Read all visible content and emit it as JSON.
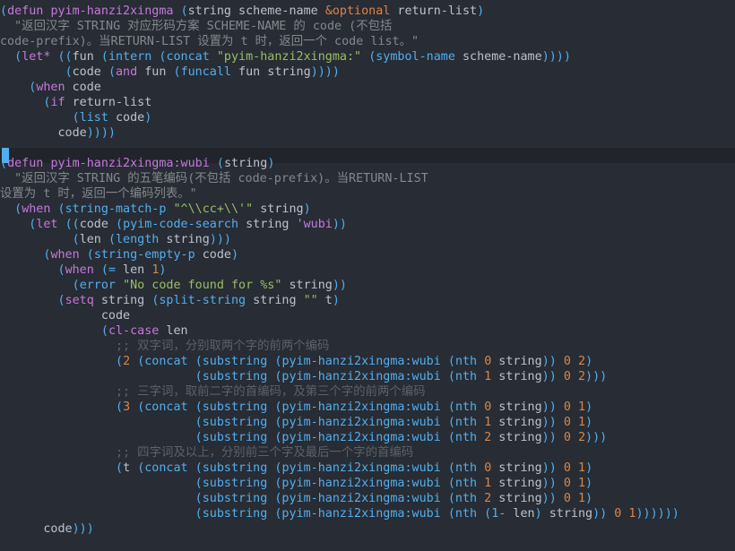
{
  "colors": {
    "background": "#282c34",
    "highlight_line": "#21242b",
    "paren": "#51afef",
    "keyword": "#c678dd",
    "string": "#98be65",
    "docstring": "#83898d",
    "comment": "#5b6268",
    "number": "#da8548",
    "text": "#bbc2cf",
    "cursor": "#51afef"
  },
  "lines": [
    [
      {
        "t": "(",
        "c": "p"
      },
      {
        "t": "defun ",
        "c": "k"
      },
      {
        "t": "pyim-hanzi2xingma",
        "c": "f"
      },
      {
        "t": " ",
        "c": "t"
      },
      {
        "t": "(",
        "c": "p"
      },
      {
        "t": "string scheme-name ",
        "c": "t"
      },
      {
        "t": "&optional",
        "c": "n"
      },
      {
        "t": " return-list",
        "c": "t"
      },
      {
        "t": ")",
        "c": "p"
      }
    ],
    [
      {
        "t": "  \"返回汉字 STRING 对应形码方案 SCHEME-NAME 的 code (不包括",
        "c": "d"
      }
    ],
    [
      {
        "t": "code-prefix)。当RETURN-LIST 设置为 t 时，返回一个 code list。\"",
        "c": "d"
      }
    ],
    [
      {
        "t": "  ",
        "c": "t"
      },
      {
        "t": "(",
        "c": "p"
      },
      {
        "t": "let*",
        "c": "k"
      },
      {
        "t": " ",
        "c": "t"
      },
      {
        "t": "((",
        "c": "p"
      },
      {
        "t": "fun ",
        "c": "t"
      },
      {
        "t": "(",
        "c": "p"
      },
      {
        "t": "intern ",
        "c": "b"
      },
      {
        "t": "(",
        "c": "p"
      },
      {
        "t": "concat ",
        "c": "b"
      },
      {
        "t": "\"pyim-hanzi2xingma:\"",
        "c": "s"
      },
      {
        "t": " ",
        "c": "t"
      },
      {
        "t": "(",
        "c": "p"
      },
      {
        "t": "symbol-name",
        "c": "b"
      },
      {
        "t": " scheme-name",
        "c": "t"
      },
      {
        "t": "))))",
        "c": "p"
      }
    ],
    [
      {
        "t": "         ",
        "c": "t"
      },
      {
        "t": "(",
        "c": "p"
      },
      {
        "t": "code ",
        "c": "t"
      },
      {
        "t": "(",
        "c": "p"
      },
      {
        "t": "and",
        "c": "k"
      },
      {
        "t": " fun ",
        "c": "t"
      },
      {
        "t": "(",
        "c": "p"
      },
      {
        "t": "funcall",
        "c": "b"
      },
      {
        "t": " fun string",
        "c": "t"
      },
      {
        "t": "))))",
        "c": "p"
      }
    ],
    [
      {
        "t": "    ",
        "c": "t"
      },
      {
        "t": "(",
        "c": "p"
      },
      {
        "t": "when",
        "c": "k"
      },
      {
        "t": " code",
        "c": "t"
      }
    ],
    [
      {
        "t": "      ",
        "c": "t"
      },
      {
        "t": "(",
        "c": "p"
      },
      {
        "t": "if",
        "c": "k"
      },
      {
        "t": " return-list",
        "c": "t"
      }
    ],
    [
      {
        "t": "          ",
        "c": "t"
      },
      {
        "t": "(",
        "c": "p"
      },
      {
        "t": "list",
        "c": "b"
      },
      {
        "t": " code",
        "c": "t"
      },
      {
        "t": ")",
        "c": "p"
      }
    ],
    [
      {
        "t": "        code",
        "c": "t"
      },
      {
        "t": "))))",
        "c": "p"
      }
    ],
    [],
    [
      {
        "t": "(",
        "c": "p"
      },
      {
        "t": "defun ",
        "c": "k"
      },
      {
        "t": "pyim-hanzi2xingma:wubi",
        "c": "f"
      },
      {
        "t": " ",
        "c": "t"
      },
      {
        "t": "(",
        "c": "p"
      },
      {
        "t": "string",
        "c": "t"
      },
      {
        "t": ")",
        "c": "p"
      }
    ],
    [
      {
        "t": "  \"返回汉字 STRING 的五笔编码(不包括 code-prefix)。当RETURN-LIST",
        "c": "d"
      }
    ],
    [
      {
        "t": "设置为 t 时，返回一个编码列表。\"",
        "c": "d"
      }
    ],
    [
      {
        "t": "  ",
        "c": "t"
      },
      {
        "t": "(",
        "c": "p"
      },
      {
        "t": "when",
        "c": "k"
      },
      {
        "t": " ",
        "c": "t"
      },
      {
        "t": "(",
        "c": "p"
      },
      {
        "t": "string-match-p",
        "c": "b"
      },
      {
        "t": " ",
        "c": "t"
      },
      {
        "t": "\"^\\\\cc+\\\\'\"",
        "c": "s"
      },
      {
        "t": " string",
        "c": "t"
      },
      {
        "t": ")",
        "c": "p"
      }
    ],
    [
      {
        "t": "    ",
        "c": "t"
      },
      {
        "t": "(",
        "c": "p"
      },
      {
        "t": "let",
        "c": "k"
      },
      {
        "t": " ",
        "c": "t"
      },
      {
        "t": "((",
        "c": "p"
      },
      {
        "t": "code ",
        "c": "t"
      },
      {
        "t": "(",
        "c": "p"
      },
      {
        "t": "pyim-code-search",
        "c": "b"
      },
      {
        "t": " string ",
        "c": "t"
      },
      {
        "t": "'wubi",
        "c": "k"
      },
      {
        "t": "))",
        "c": "p"
      }
    ],
    [
      {
        "t": "          ",
        "c": "t"
      },
      {
        "t": "(",
        "c": "p"
      },
      {
        "t": "len ",
        "c": "t"
      },
      {
        "t": "(",
        "c": "p"
      },
      {
        "t": "length",
        "c": "b"
      },
      {
        "t": " string",
        "c": "t"
      },
      {
        "t": ")))",
        "c": "p"
      }
    ],
    [
      {
        "t": "      ",
        "c": "t"
      },
      {
        "t": "(",
        "c": "p"
      },
      {
        "t": "when",
        "c": "k"
      },
      {
        "t": " ",
        "c": "t"
      },
      {
        "t": "(",
        "c": "p"
      },
      {
        "t": "string-empty-p",
        "c": "b"
      },
      {
        "t": " code",
        "c": "t"
      },
      {
        "t": ")",
        "c": "p"
      }
    ],
    [
      {
        "t": "        ",
        "c": "t"
      },
      {
        "t": "(",
        "c": "p"
      },
      {
        "t": "when",
        "c": "k"
      },
      {
        "t": " ",
        "c": "t"
      },
      {
        "t": "(",
        "c": "p"
      },
      {
        "t": "=",
        "c": "b"
      },
      {
        "t": " len ",
        "c": "t"
      },
      {
        "t": "1",
        "c": "n"
      },
      {
        "t": ")",
        "c": "p"
      }
    ],
    [
      {
        "t": "          ",
        "c": "t"
      },
      {
        "t": "(",
        "c": "p"
      },
      {
        "t": "error",
        "c": "b"
      },
      {
        "t": " ",
        "c": "t"
      },
      {
        "t": "\"No code found for %s\"",
        "c": "s"
      },
      {
        "t": " string",
        "c": "t"
      },
      {
        "t": "))",
        "c": "p"
      }
    ],
    [
      {
        "t": "        ",
        "c": "t"
      },
      {
        "t": "(",
        "c": "p"
      },
      {
        "t": "setq",
        "c": "k"
      },
      {
        "t": " string ",
        "c": "t"
      },
      {
        "t": "(",
        "c": "p"
      },
      {
        "t": "split-string",
        "c": "b"
      },
      {
        "t": " string ",
        "c": "t"
      },
      {
        "t": "\"\"",
        "c": "s"
      },
      {
        "t": " t",
        "c": "t"
      },
      {
        "t": ")",
        "c": "p"
      }
    ],
    [
      {
        "t": "              code",
        "c": "t"
      }
    ],
    [
      {
        "t": "              ",
        "c": "t"
      },
      {
        "t": "(",
        "c": "p"
      },
      {
        "t": "cl-case",
        "c": "k"
      },
      {
        "t": " len",
        "c": "t"
      }
    ],
    [
      {
        "t": "                ;; 双字词，分别取两个字的前两个编码",
        "c": "c"
      }
    ],
    [
      {
        "t": "                ",
        "c": "t"
      },
      {
        "t": "(",
        "c": "p"
      },
      {
        "t": "2",
        "c": "n"
      },
      {
        "t": " ",
        "c": "t"
      },
      {
        "t": "(",
        "c": "p"
      },
      {
        "t": "concat",
        "c": "b"
      },
      {
        "t": " ",
        "c": "t"
      },
      {
        "t": "(",
        "c": "p"
      },
      {
        "t": "substring",
        "c": "b"
      },
      {
        "t": " ",
        "c": "t"
      },
      {
        "t": "(",
        "c": "p"
      },
      {
        "t": "pyim-hanzi2xingma:wubi",
        "c": "b"
      },
      {
        "t": " ",
        "c": "t"
      },
      {
        "t": "(",
        "c": "p"
      },
      {
        "t": "nth ",
        "c": "b"
      },
      {
        "t": "0",
        "c": "n"
      },
      {
        "t": " string",
        "c": "t"
      },
      {
        "t": "))",
        "c": "p"
      },
      {
        "t": " ",
        "c": "t"
      },
      {
        "t": "0",
        "c": "n"
      },
      {
        "t": " ",
        "c": "t"
      },
      {
        "t": "2",
        "c": "n"
      },
      {
        "t": ")",
        "c": "p"
      }
    ],
    [
      {
        "t": "                           ",
        "c": "t"
      },
      {
        "t": "(",
        "c": "p"
      },
      {
        "t": "substring",
        "c": "b"
      },
      {
        "t": " ",
        "c": "t"
      },
      {
        "t": "(",
        "c": "p"
      },
      {
        "t": "pyim-hanzi2xingma:wubi",
        "c": "b"
      },
      {
        "t": " ",
        "c": "t"
      },
      {
        "t": "(",
        "c": "p"
      },
      {
        "t": "nth ",
        "c": "b"
      },
      {
        "t": "1",
        "c": "n"
      },
      {
        "t": " string",
        "c": "t"
      },
      {
        "t": "))",
        "c": "p"
      },
      {
        "t": " ",
        "c": "t"
      },
      {
        "t": "0",
        "c": "n"
      },
      {
        "t": " ",
        "c": "t"
      },
      {
        "t": "2",
        "c": "n"
      },
      {
        "t": ")))",
        "c": "p"
      }
    ],
    [
      {
        "t": "                ;; 三字词，取前二字的首编码，及第三个字的前两个编码",
        "c": "c"
      }
    ],
    [
      {
        "t": "                ",
        "c": "t"
      },
      {
        "t": "(",
        "c": "p"
      },
      {
        "t": "3",
        "c": "n"
      },
      {
        "t": " ",
        "c": "t"
      },
      {
        "t": "(",
        "c": "p"
      },
      {
        "t": "concat",
        "c": "b"
      },
      {
        "t": " ",
        "c": "t"
      },
      {
        "t": "(",
        "c": "p"
      },
      {
        "t": "substring",
        "c": "b"
      },
      {
        "t": " ",
        "c": "t"
      },
      {
        "t": "(",
        "c": "p"
      },
      {
        "t": "pyim-hanzi2xingma:wubi",
        "c": "b"
      },
      {
        "t": " ",
        "c": "t"
      },
      {
        "t": "(",
        "c": "p"
      },
      {
        "t": "nth ",
        "c": "b"
      },
      {
        "t": "0",
        "c": "n"
      },
      {
        "t": " string",
        "c": "t"
      },
      {
        "t": "))",
        "c": "p"
      },
      {
        "t": " ",
        "c": "t"
      },
      {
        "t": "0",
        "c": "n"
      },
      {
        "t": " ",
        "c": "t"
      },
      {
        "t": "1",
        "c": "n"
      },
      {
        "t": ")",
        "c": "p"
      }
    ],
    [
      {
        "t": "                           ",
        "c": "t"
      },
      {
        "t": "(",
        "c": "p"
      },
      {
        "t": "substring",
        "c": "b"
      },
      {
        "t": " ",
        "c": "t"
      },
      {
        "t": "(",
        "c": "p"
      },
      {
        "t": "pyim-hanzi2xingma:wubi",
        "c": "b"
      },
      {
        "t": " ",
        "c": "t"
      },
      {
        "t": "(",
        "c": "p"
      },
      {
        "t": "nth ",
        "c": "b"
      },
      {
        "t": "1",
        "c": "n"
      },
      {
        "t": " string",
        "c": "t"
      },
      {
        "t": "))",
        "c": "p"
      },
      {
        "t": " ",
        "c": "t"
      },
      {
        "t": "0",
        "c": "n"
      },
      {
        "t": " ",
        "c": "t"
      },
      {
        "t": "1",
        "c": "n"
      },
      {
        "t": ")",
        "c": "p"
      }
    ],
    [
      {
        "t": "                           ",
        "c": "t"
      },
      {
        "t": "(",
        "c": "p"
      },
      {
        "t": "substring",
        "c": "b"
      },
      {
        "t": " ",
        "c": "t"
      },
      {
        "t": "(",
        "c": "p"
      },
      {
        "t": "pyim-hanzi2xingma:wubi",
        "c": "b"
      },
      {
        "t": " ",
        "c": "t"
      },
      {
        "t": "(",
        "c": "p"
      },
      {
        "t": "nth ",
        "c": "b"
      },
      {
        "t": "2",
        "c": "n"
      },
      {
        "t": " string",
        "c": "t"
      },
      {
        "t": "))",
        "c": "p"
      },
      {
        "t": " ",
        "c": "t"
      },
      {
        "t": "0",
        "c": "n"
      },
      {
        "t": " ",
        "c": "t"
      },
      {
        "t": "2",
        "c": "n"
      },
      {
        "t": ")))",
        "c": "p"
      }
    ],
    [
      {
        "t": "                ;; 四字词及以上，分别前三个字及最后一个字的首编码",
        "c": "c"
      }
    ],
    [
      {
        "t": "                ",
        "c": "t"
      },
      {
        "t": "(",
        "c": "p"
      },
      {
        "t": "t",
        "c": "t"
      },
      {
        "t": " ",
        "c": "t"
      },
      {
        "t": "(",
        "c": "p"
      },
      {
        "t": "concat",
        "c": "b"
      },
      {
        "t": " ",
        "c": "t"
      },
      {
        "t": "(",
        "c": "p"
      },
      {
        "t": "substring",
        "c": "b"
      },
      {
        "t": " ",
        "c": "t"
      },
      {
        "t": "(",
        "c": "p"
      },
      {
        "t": "pyim-hanzi2xingma:wubi",
        "c": "b"
      },
      {
        "t": " ",
        "c": "t"
      },
      {
        "t": "(",
        "c": "p"
      },
      {
        "t": "nth ",
        "c": "b"
      },
      {
        "t": "0",
        "c": "n"
      },
      {
        "t": " string",
        "c": "t"
      },
      {
        "t": "))",
        "c": "p"
      },
      {
        "t": " ",
        "c": "t"
      },
      {
        "t": "0",
        "c": "n"
      },
      {
        "t": " ",
        "c": "t"
      },
      {
        "t": "1",
        "c": "n"
      },
      {
        "t": ")",
        "c": "p"
      }
    ],
    [
      {
        "t": "                           ",
        "c": "t"
      },
      {
        "t": "(",
        "c": "p"
      },
      {
        "t": "substring",
        "c": "b"
      },
      {
        "t": " ",
        "c": "t"
      },
      {
        "t": "(",
        "c": "p"
      },
      {
        "t": "pyim-hanzi2xingma:wubi",
        "c": "b"
      },
      {
        "t": " ",
        "c": "t"
      },
      {
        "t": "(",
        "c": "p"
      },
      {
        "t": "nth ",
        "c": "b"
      },
      {
        "t": "1",
        "c": "n"
      },
      {
        "t": " string",
        "c": "t"
      },
      {
        "t": "))",
        "c": "p"
      },
      {
        "t": " ",
        "c": "t"
      },
      {
        "t": "0",
        "c": "n"
      },
      {
        "t": " ",
        "c": "t"
      },
      {
        "t": "1",
        "c": "n"
      },
      {
        "t": ")",
        "c": "p"
      }
    ],
    [
      {
        "t": "                           ",
        "c": "t"
      },
      {
        "t": "(",
        "c": "p"
      },
      {
        "t": "substring",
        "c": "b"
      },
      {
        "t": " ",
        "c": "t"
      },
      {
        "t": "(",
        "c": "p"
      },
      {
        "t": "pyim-hanzi2xingma:wubi",
        "c": "b"
      },
      {
        "t": " ",
        "c": "t"
      },
      {
        "t": "(",
        "c": "p"
      },
      {
        "t": "nth ",
        "c": "b"
      },
      {
        "t": "2",
        "c": "n"
      },
      {
        "t": " string",
        "c": "t"
      },
      {
        "t": "))",
        "c": "p"
      },
      {
        "t": " ",
        "c": "t"
      },
      {
        "t": "0",
        "c": "n"
      },
      {
        "t": " ",
        "c": "t"
      },
      {
        "t": "1",
        "c": "n"
      },
      {
        "t": ")",
        "c": "p"
      }
    ],
    [
      {
        "t": "                           ",
        "c": "t"
      },
      {
        "t": "(",
        "c": "p"
      },
      {
        "t": "substring",
        "c": "b"
      },
      {
        "t": " ",
        "c": "t"
      },
      {
        "t": "(",
        "c": "p"
      },
      {
        "t": "pyim-hanzi2xingma:wubi",
        "c": "b"
      },
      {
        "t": " ",
        "c": "t"
      },
      {
        "t": "(",
        "c": "p"
      },
      {
        "t": "nth ",
        "c": "b"
      },
      {
        "t": "(",
        "c": "p"
      },
      {
        "t": "1-",
        "c": "b"
      },
      {
        "t": " len",
        "c": "t"
      },
      {
        "t": ")",
        "c": "p"
      },
      {
        "t": " string",
        "c": "t"
      },
      {
        "t": "))",
        "c": "p"
      },
      {
        "t": " ",
        "c": "t"
      },
      {
        "t": "0",
        "c": "n"
      },
      {
        "t": " ",
        "c": "t"
      },
      {
        "t": "1",
        "c": "n"
      },
      {
        "t": "))))))",
        "c": "p"
      }
    ],
    [
      {
        "t": "      code",
        "c": "t"
      },
      {
        "t": ")))",
        "c": "p"
      }
    ]
  ]
}
